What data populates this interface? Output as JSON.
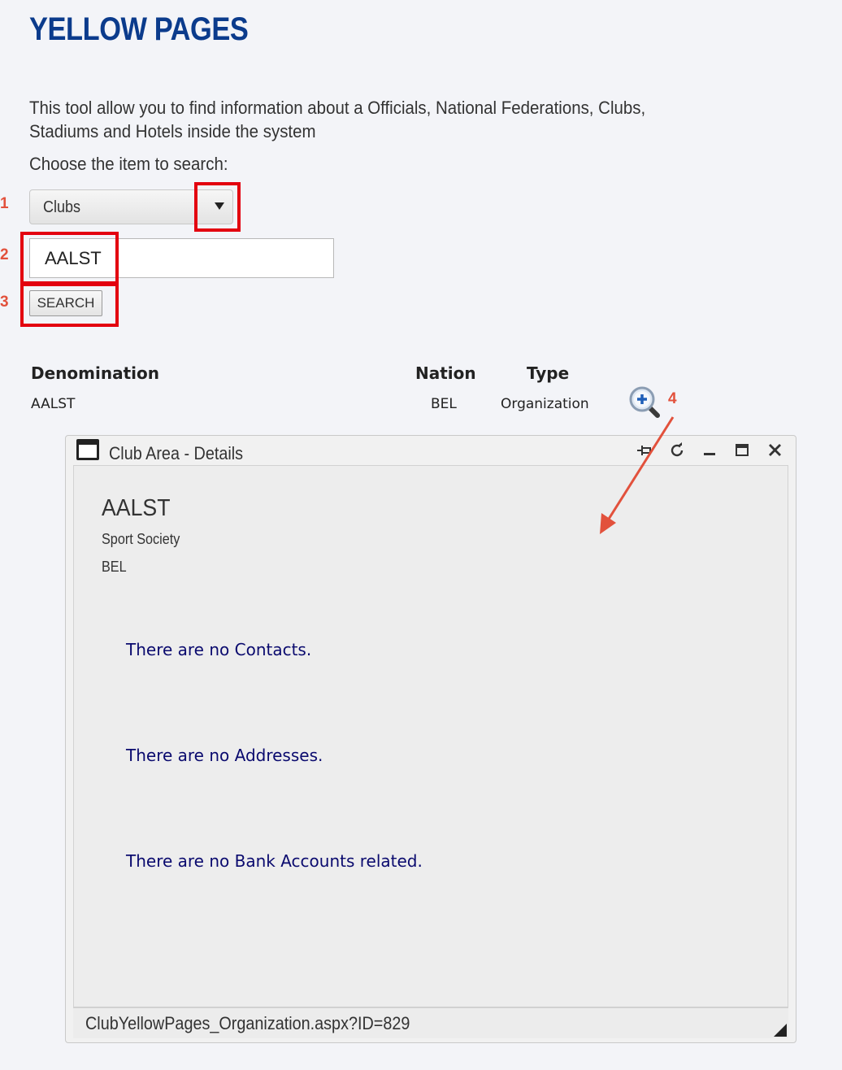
{
  "page": {
    "title": "YELLOW PAGES",
    "intro": "This tool allow you to find information about a Officials, National Federations, Clubs, Stadiums and Hotels inside the system",
    "choose_label": "Choose the item to search:"
  },
  "search": {
    "selected_item": "Clubs",
    "query": "AALST",
    "button_label": "SEARCH"
  },
  "annotations": [
    "1",
    "2",
    "3",
    "4"
  ],
  "results": {
    "headers": {
      "denomination": "Denomination",
      "nation": "Nation",
      "type": "Type"
    },
    "rows": [
      {
        "denomination": "AALST",
        "nation": "BEL",
        "type": "Organization"
      }
    ]
  },
  "details_window": {
    "title": "Club Area - Details",
    "club_name": "AALST",
    "club_type": "Sport Society",
    "nation": "BEL",
    "no_contacts": "There are no Contacts.",
    "no_addresses": "There are no Addresses.",
    "no_bank_accounts": "There are no Bank Accounts related.",
    "status_url": "ClubYellowPages_Organization.aspx?ID=829"
  },
  "colors": {
    "title_blue": "#0b3b8c",
    "annotation_red": "#e3000f",
    "marker_red": "#e2513c",
    "note_navy": "#0a0a6e"
  },
  "icons": [
    "dropdown-arrow-icon",
    "zoom-in-icon",
    "window-icon",
    "pin-icon",
    "refresh-icon",
    "minimize-icon",
    "maximize-icon",
    "close-icon",
    "resize-grip-icon"
  ]
}
